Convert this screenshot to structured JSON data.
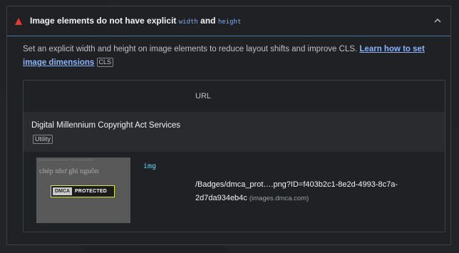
{
  "audit": {
    "title_prefix": "Image elements do not have explicit ",
    "code_width": "width",
    "title_and": " and ",
    "code_height": "height",
    "description": "Set an explicit width and height on image elements to reduce layout shifts and improve CLS. ",
    "learn_link": "Learn how to set image dimensions",
    "tag": "CLS"
  },
  "table": {
    "header_url": "URL",
    "entity": {
      "name": "Digital Millennium Copyright Act Services",
      "tag": "Utility"
    },
    "item": {
      "node": "img",
      "url_line1": "/Badges/dmca_prot….png?ID=f403b2c1-8e2d-4993-8c7a-",
      "url_line2": "2d7da934eb4c",
      "domain": "(images.dmca.com)",
      "thumb_text": "chép nhơ ghi nguồn",
      "badge_left": "DMCA",
      "badge_right": "PROTECTED"
    }
  },
  "colors": {
    "warning": "#e53935",
    "accent_border": "#4a76a8",
    "link": "#8ab4f8",
    "node": "#5cd5fb"
  },
  "icons": [
    "warning-triangle-icon",
    "chevron-up-icon"
  ]
}
